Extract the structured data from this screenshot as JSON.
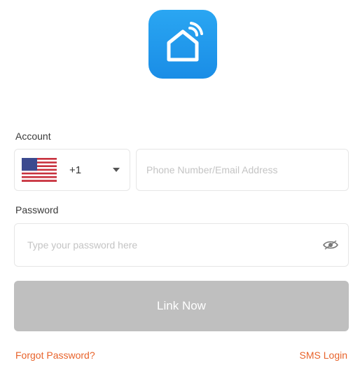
{
  "logo": {
    "icon": "smart-home-icon",
    "color": "#1a8de6"
  },
  "account": {
    "label": "Account",
    "country": {
      "flag": "us-flag-icon",
      "code": "+1"
    },
    "placeholder": "Phone Number/Email Address"
  },
  "password": {
    "label": "Password",
    "placeholder": "Type your password here"
  },
  "link_now_label": "Link Now",
  "forgot_password_label": "Forgot Password?",
  "sms_login_label": "SMS Login",
  "colors": {
    "accent": "#e8632b",
    "button_disabled": "#bfbfbf"
  }
}
